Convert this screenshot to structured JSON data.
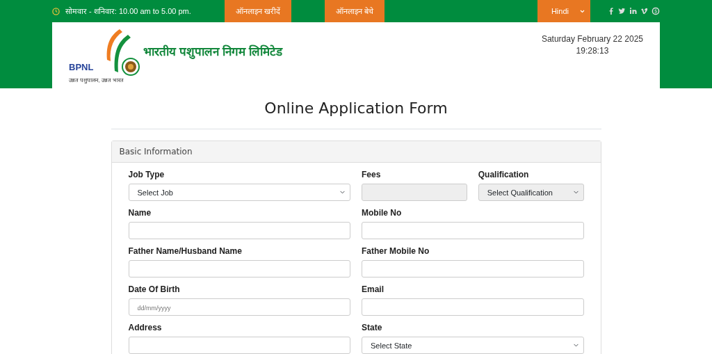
{
  "topbar": {
    "hours": "सोमवार - शनिवार: 10.00 am to 5.00 pm.",
    "buttons": [
      "ऑनलाइन खरीदें",
      "ऑनलाइन बेचे"
    ],
    "language": "Hindi"
  },
  "header": {
    "org_name": "भारतीय पशुपालन निगम लिमिटेड",
    "logo_text": "BPNL",
    "tagline": "उन्नत पशुपालन, उन्नत भारत",
    "date": "Saturday February 22 2025",
    "time": "19:28:13"
  },
  "form": {
    "title": "Online Application Form",
    "section": "Basic Information",
    "rows": [
      [
        {
          "label": "Job Type",
          "kind": "select",
          "value": "Select Job",
          "disabled": false
        },
        {
          "label": "Fees",
          "kind": "input",
          "disabled": true
        },
        {
          "label": "Qualification",
          "kind": "select",
          "value": "Select Qualification",
          "disabled": true
        }
      ],
      [
        {
          "label": "Name",
          "kind": "input",
          "disabled": false
        },
        {
          "label": "Mobile No",
          "kind": "input",
          "disabled": false
        }
      ],
      [
        {
          "label": "Father Name/Husband Name",
          "kind": "input",
          "disabled": false
        },
        {
          "label": "Father Mobile No",
          "kind": "input",
          "disabled": false
        }
      ],
      [
        {
          "label": "Date Of Birth",
          "kind": "input",
          "placeholder": "dd/mm/yyyy",
          "disabled": false
        },
        {
          "label": "Email",
          "kind": "input",
          "disabled": false
        }
      ],
      [
        {
          "label": "Address",
          "kind": "input",
          "disabled": false
        },
        {
          "label": "State",
          "kind": "select",
          "value": "Select State",
          "disabled": false
        }
      ]
    ]
  }
}
